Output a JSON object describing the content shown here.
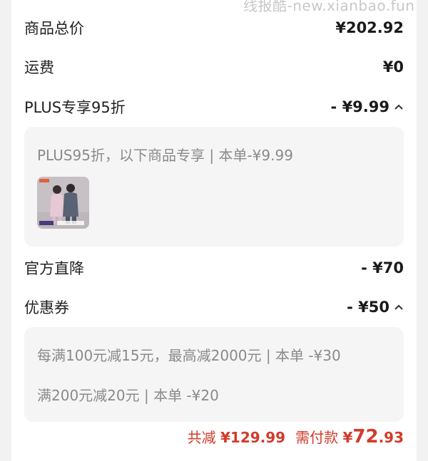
{
  "watermark": "线报酷-new.xianbao.fun",
  "rows": {
    "subtotal": {
      "label": "商品总价",
      "value": "¥202.92"
    },
    "shipping": {
      "label": "运费",
      "value": "¥0"
    },
    "plus": {
      "label": "PLUS专享95折",
      "value": "- ¥9.99"
    },
    "official": {
      "label": "官方直降",
      "value": "- ¥70"
    },
    "coupon": {
      "label": "优惠券",
      "value": "- ¥50"
    }
  },
  "plus_panel": {
    "text": "PLUS95折，以下商品专享 | 本单-¥9.99"
  },
  "coupon_panel": {
    "lines": [
      "每满100元减15元，最高减2000元 | 本单 -¥30",
      "满200元减20元 | 本单 -¥20"
    ]
  },
  "footer": {
    "total_saved_label": "共减",
    "total_saved_value": "¥129.99",
    "pay_label": "需付款",
    "pay_currency": "¥",
    "pay_int": "72",
    "pay_dec": ".93"
  },
  "colors": {
    "accent": "#d23b2b",
    "panel_bg": "#f5f5f5",
    "page_bg": "#f2f2f2"
  },
  "icons": {
    "plus_toggle": "chevron-up-icon",
    "coupon_toggle": "chevron-up-icon",
    "product_thumb": "product-image"
  }
}
